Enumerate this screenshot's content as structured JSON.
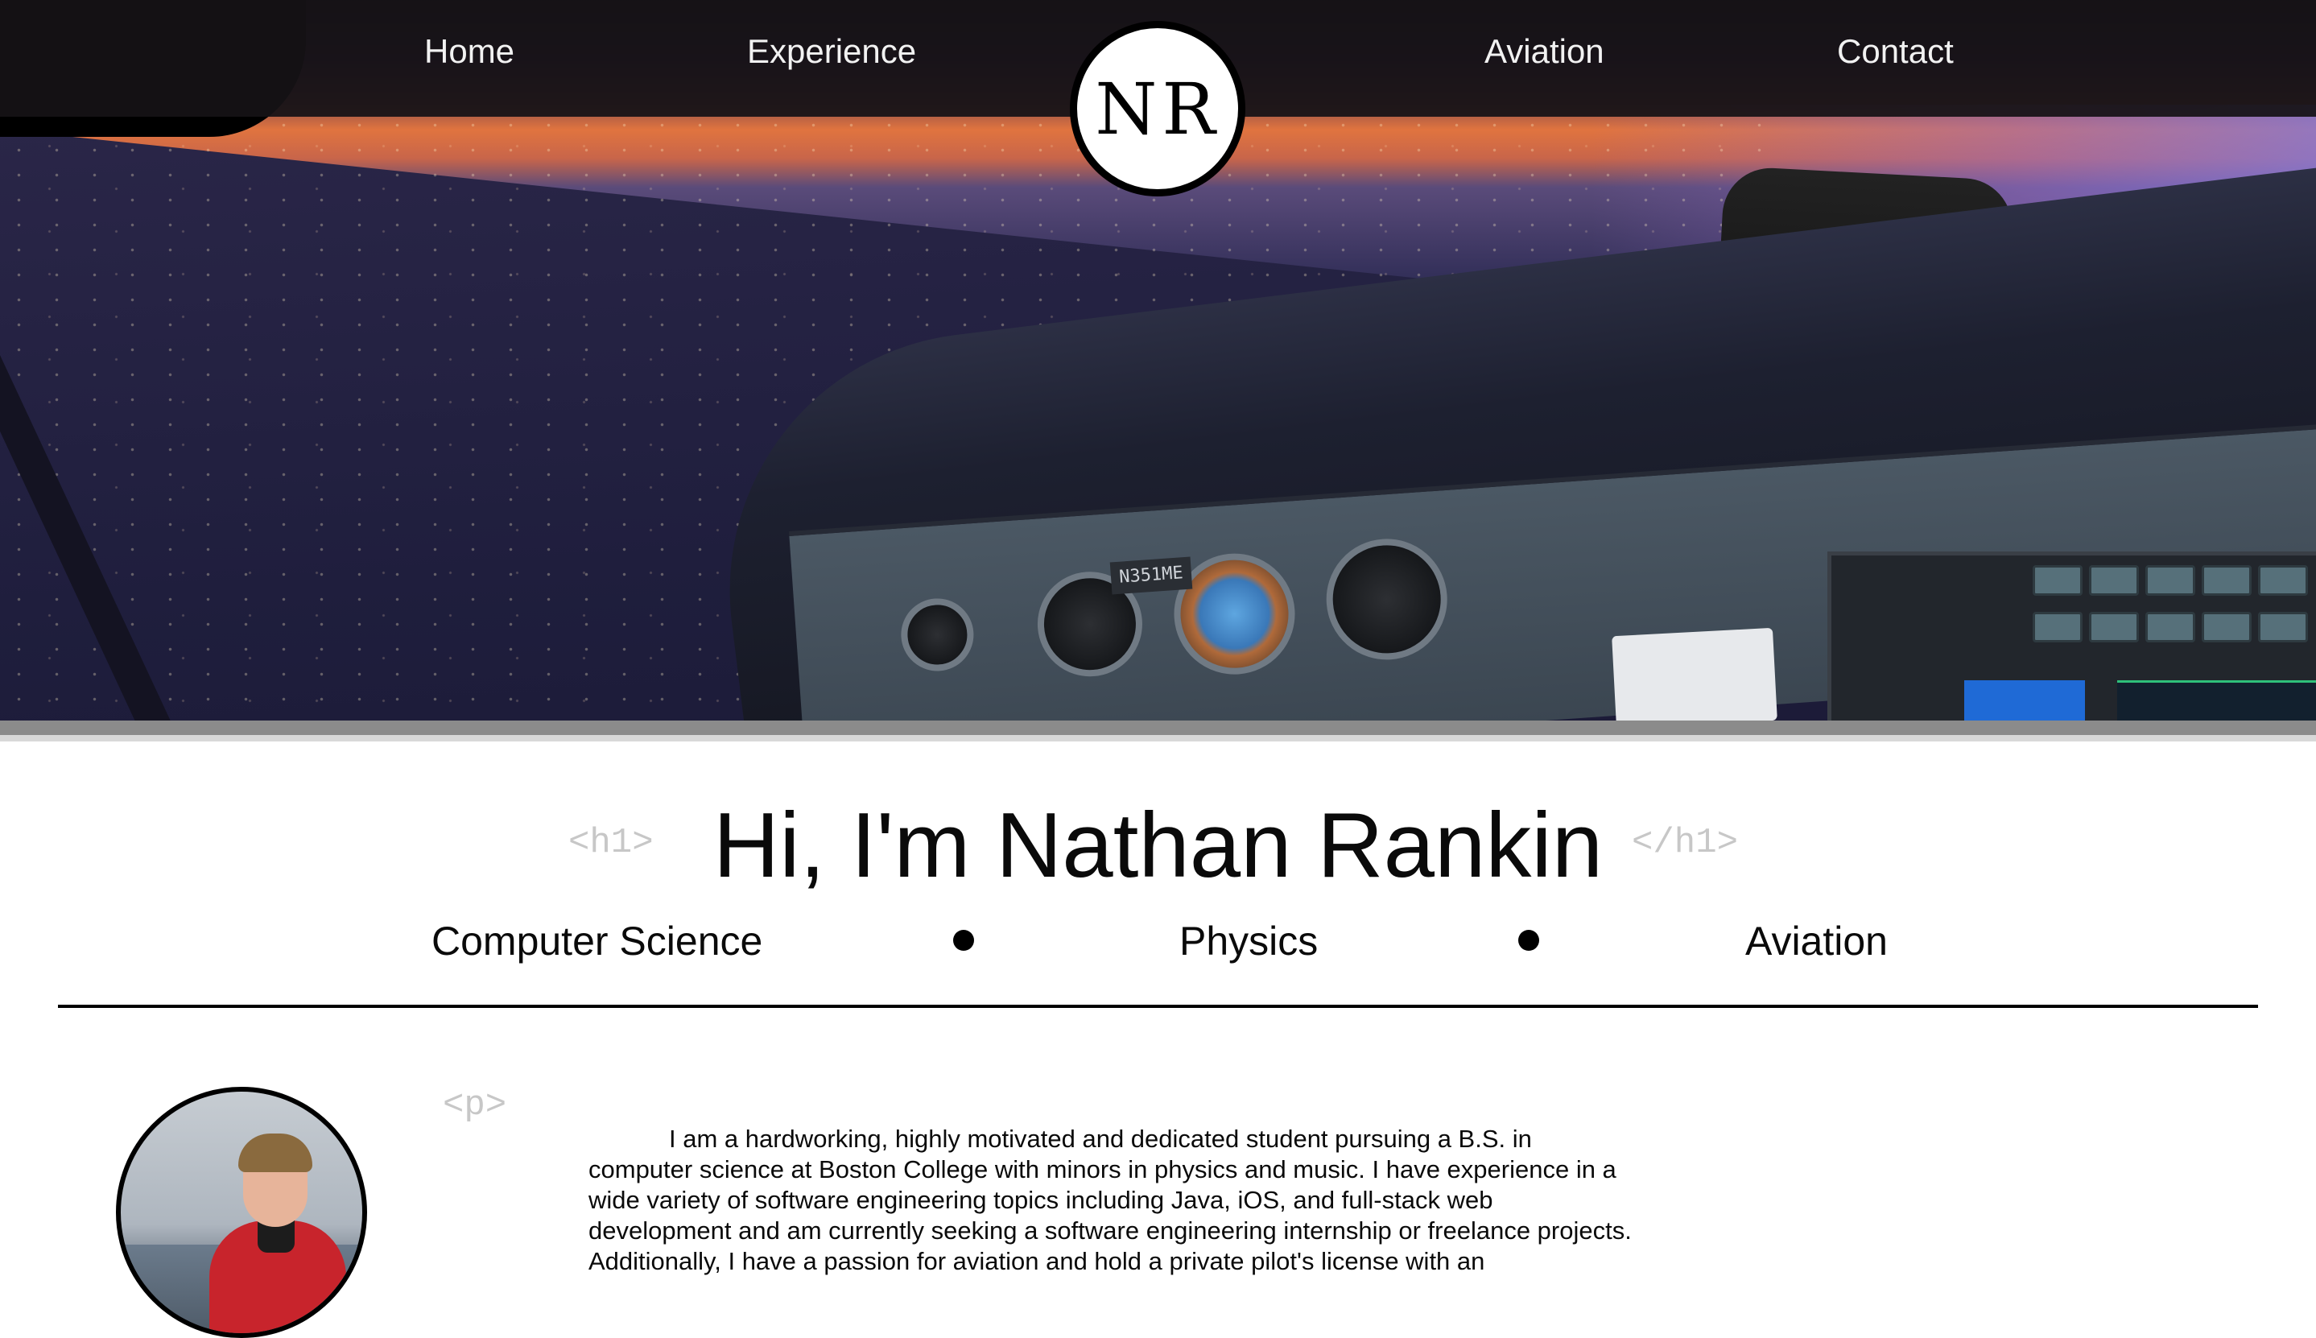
{
  "nav": {
    "links": [
      "Home",
      "Experience",
      "Aviation",
      "Contact"
    ],
    "logo_text": "NR"
  },
  "hero": {
    "tail_number": "N351ME"
  },
  "intro": {
    "h1_open_tag": "<h1>",
    "h1_close_tag": "</h1>",
    "headline": "Hi, I'm Nathan Rankin",
    "topics": [
      "Computer Science",
      "Physics",
      "Aviation"
    ]
  },
  "about": {
    "p_open_tag": "<p>",
    "bio": "I am a hardworking, highly motivated and dedicated student pursuing a B.S. in computer science at Boston College with minors in physics and music. I have experience in a wide variety of software engineering topics including Java, iOS, and full-stack web development and am currently seeking a software engineering internship or freelance projects. Additionally, I have a passion for aviation and hold a private pilot's license with an"
  },
  "colors": {
    "nav_background": "#161216",
    "nav_text": "#f2f2f2",
    "tag_gray": "#c7c7c7",
    "text": "#0a0a0a"
  }
}
